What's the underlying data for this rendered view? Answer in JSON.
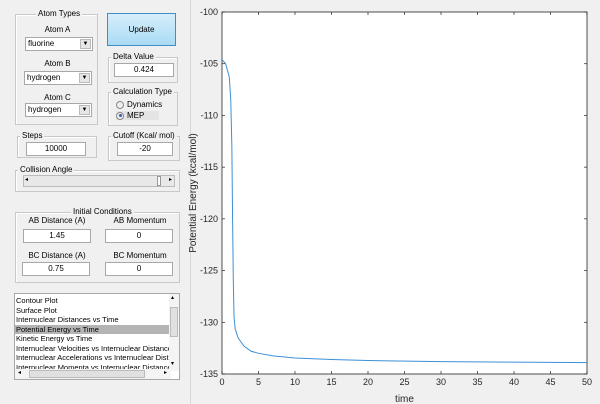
{
  "atom_types": {
    "title": "Atom Types",
    "atom_a": {
      "label": "Atom A",
      "value": "fluorine"
    },
    "atom_b": {
      "label": "Atom B",
      "value": "hydrogen"
    },
    "atom_c": {
      "label": "Atom C",
      "value": "hydrogen"
    }
  },
  "update_label": "Update",
  "delta": {
    "title": "Delta Value",
    "value": "0.424"
  },
  "calc": {
    "title": "Calculation Type",
    "options": [
      "Dynamics",
      "MEP"
    ],
    "selected": "MEP"
  },
  "steps": {
    "title": "Steps",
    "value": "10000"
  },
  "cutoff": {
    "title": "Cutoff (Kcal/ mol)",
    "value": "-20"
  },
  "collision": {
    "title": "Collision Angle"
  },
  "initial": {
    "title": "Initial Conditions",
    "ab_dist_label": "AB Distance (A)",
    "ab_dist": "1.45",
    "ab_mom_label": "AB Momentum",
    "ab_mom": "0",
    "bc_dist_label": "BC Distance (A)",
    "bc_dist": "0.75",
    "bc_mom_label": "BC Momentum",
    "bc_mom": "0"
  },
  "plot_list": {
    "items": [
      "Contour Plot",
      "Surface Plot",
      "Internuclear Distances vs Time",
      "Potential Energy vs Time",
      "Kinetic Energy vs Time",
      "Internuclear Velocities vs Internuclear Distance",
      "Internuclear Accelerations vs Internuclear Distance",
      "Internuclear Momenta vs Internuclear Distance"
    ],
    "selected": 3
  },
  "chart_data": {
    "type": "line",
    "xlabel": "time",
    "ylabel": "Potential Energy (kcal/mol)",
    "xlim": [
      0,
      50
    ],
    "ylim": [
      -135,
      -100
    ],
    "xticks": [
      0,
      5,
      10,
      15,
      20,
      25,
      30,
      35,
      40,
      45,
      50
    ],
    "yticks": [
      -100,
      -105,
      -110,
      -115,
      -120,
      -125,
      -130,
      -135
    ],
    "color": "#3d8fd6",
    "x": [
      0,
      0.5,
      1,
      1.2,
      1.35,
      1.45,
      1.55,
      1.65,
      1.8,
      2.2,
      3,
      4,
      5,
      7,
      10,
      15,
      20,
      30,
      40,
      50
    ],
    "y": [
      -104.6,
      -105,
      -106.3,
      -108.5,
      -113,
      -120,
      -126,
      -129.5,
      -130.6,
      -131.5,
      -132.3,
      -132.8,
      -133.0,
      -133.25,
      -133.45,
      -133.6,
      -133.7,
      -133.8,
      -133.85,
      -133.9
    ]
  }
}
